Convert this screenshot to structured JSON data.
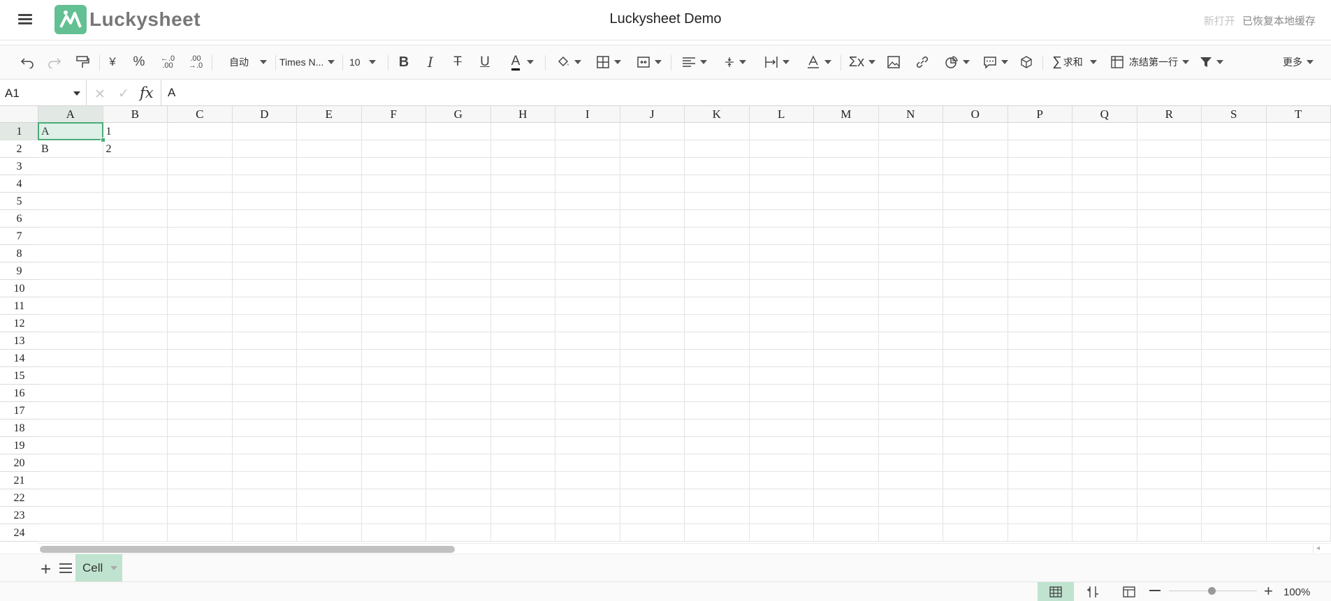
{
  "header": {
    "app_name": "Luckysheet",
    "doc_title": "Luckysheet Demo",
    "status_new_open": "新打开",
    "status_restored": "已恢复本地缓存"
  },
  "toolbar": {
    "text_wrap": "自动",
    "font_name": "Times N...",
    "font_size": "10",
    "sum_label": "求和",
    "freeze_label": "冻结第一行",
    "more_label": "更多",
    "icons": [
      "undo-icon",
      "redo-icon",
      "format-painter-icon",
      "currency-icon",
      "percent-icon",
      "decrease-decimal-icon",
      "increase-decimal-icon",
      "bold-icon",
      "italic-icon",
      "strikethrough-icon",
      "underline-icon",
      "text-color-icon",
      "fill-color-icon",
      "border-icon",
      "merge-cells-icon",
      "horizontal-align-icon",
      "vertical-align-icon",
      "text-overflow-icon",
      "text-rotate-icon",
      "function-icon",
      "image-icon",
      "link-icon",
      "chart-icon",
      "comment-icon",
      "pivot-table-icon",
      "sum-icon",
      "freeze-icon",
      "filter-icon"
    ],
    "text_color_underline": "#000000"
  },
  "formula_bar": {
    "cell_ref": "A1",
    "fx_label": "fx",
    "value": "A"
  },
  "grid": {
    "columns": [
      "A",
      "B",
      "C",
      "D",
      "E",
      "F",
      "G",
      "H",
      "I",
      "J",
      "K",
      "L",
      "M",
      "N",
      "O",
      "P",
      "Q",
      "R",
      "S",
      "T"
    ],
    "rows": [
      "1",
      "2",
      "3",
      "4",
      "5",
      "6",
      "7",
      "8",
      "9",
      "10",
      "11",
      "12",
      "13",
      "14",
      "15",
      "16",
      "17",
      "18",
      "19",
      "20",
      "21",
      "22",
      "23",
      "24"
    ],
    "cells": [
      {
        "ref": "A1",
        "value": "A"
      },
      {
        "ref": "B1",
        "value": "1"
      },
      {
        "ref": "A2",
        "value": "B"
      },
      {
        "ref": "B2",
        "value": "2"
      }
    ],
    "selected": "A1",
    "selection_color": "#4aab78"
  },
  "sheets": {
    "active": "Cell"
  },
  "statusbar": {
    "zoom": "100%",
    "zoom_fraction": 0.45
  }
}
